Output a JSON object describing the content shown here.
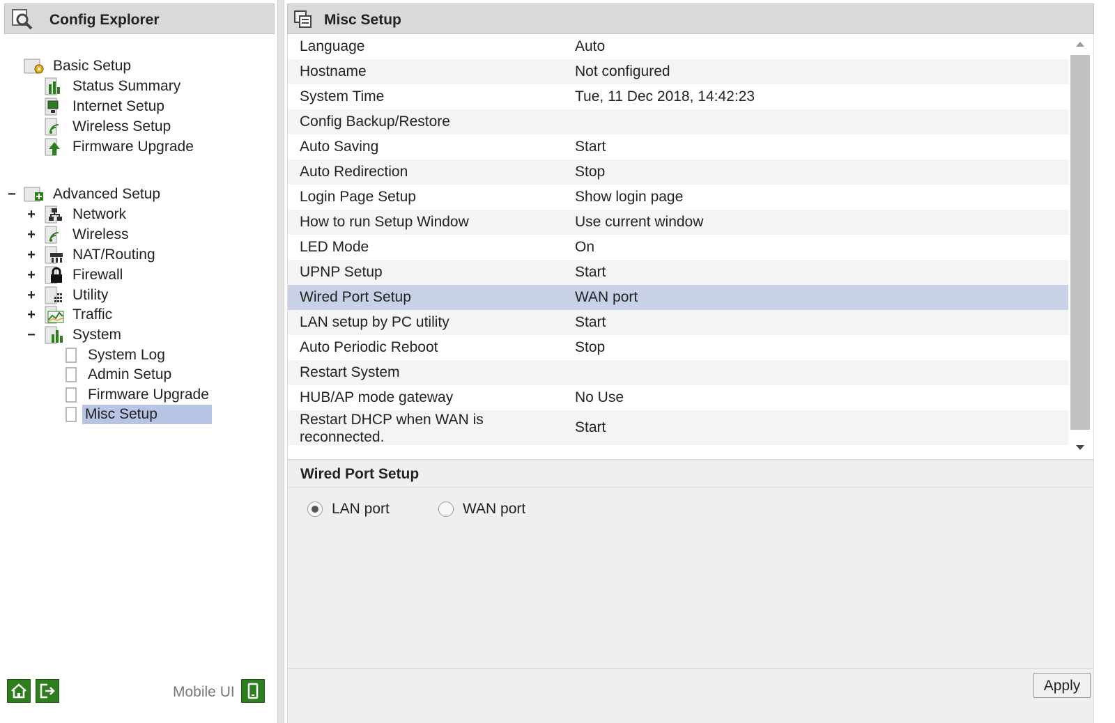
{
  "explorer": {
    "title": "Config Explorer",
    "tree": {
      "basic": {
        "label": "Basic Setup",
        "children": [
          "Status Summary",
          "Internet Setup",
          "Wireless Setup",
          "Firmware Upgrade"
        ]
      },
      "advanced": {
        "toggle": "−",
        "label": "Advanced Setup",
        "children": [
          {
            "toggle": "+",
            "label": "Network"
          },
          {
            "toggle": "+",
            "label": "Wireless"
          },
          {
            "toggle": "+",
            "label": "NAT/Routing"
          },
          {
            "toggle": "+",
            "label": "Firewall"
          },
          {
            "toggle": "+",
            "label": "Utility"
          },
          {
            "toggle": "+",
            "label": "Traffic"
          },
          {
            "toggle": "−",
            "label": "System"
          }
        ],
        "system_children": [
          "System Log",
          "Admin Setup",
          "Firmware Upgrade",
          "Misc Setup"
        ],
        "selected": "Misc Setup"
      }
    },
    "footer": {
      "mobile_label": "Mobile UI"
    }
  },
  "main": {
    "title": "Misc Setup",
    "rows": [
      {
        "name": "Language",
        "value": "Auto"
      },
      {
        "name": "Hostname",
        "value": "Not configured"
      },
      {
        "name": "System Time",
        "value": "Tue, 11 Dec 2018, 14:42:23"
      },
      {
        "name": "Config Backup/Restore",
        "value": ""
      },
      {
        "name": "Auto Saving",
        "value": "Start"
      },
      {
        "name": "Auto Redirection",
        "value": "Stop"
      },
      {
        "name": "Login Page Setup",
        "value": "Show login page"
      },
      {
        "name": "How to run Setup Window",
        "value": "Use current window"
      },
      {
        "name": "LED Mode",
        "value": "On"
      },
      {
        "name": "UPNP Setup",
        "value": "Start"
      },
      {
        "name": "Wired Port Setup",
        "value": "WAN port"
      },
      {
        "name": "LAN setup by PC utility",
        "value": "Start"
      },
      {
        "name": "Auto Periodic Reboot",
        "value": "Stop"
      },
      {
        "name": "Restart System",
        "value": ""
      },
      {
        "name": "HUB/AP mode gateway",
        "value": "No Use"
      },
      {
        "name": "Restart DHCP when WAN is reconnected.",
        "value": "Start"
      }
    ],
    "selected_row": "Wired Port Setup",
    "detail": {
      "title": "Wired Port Setup",
      "options": [
        {
          "label": "LAN port",
          "checked": true
        },
        {
          "label": "WAN port",
          "checked": false
        }
      ],
      "apply_label": "Apply"
    }
  },
  "colors": {
    "header_bg": "#d9d9d9",
    "selection": "#b8c4e4",
    "row_selection": "#c9d1e6",
    "footer_button": "#2e7d1e"
  }
}
